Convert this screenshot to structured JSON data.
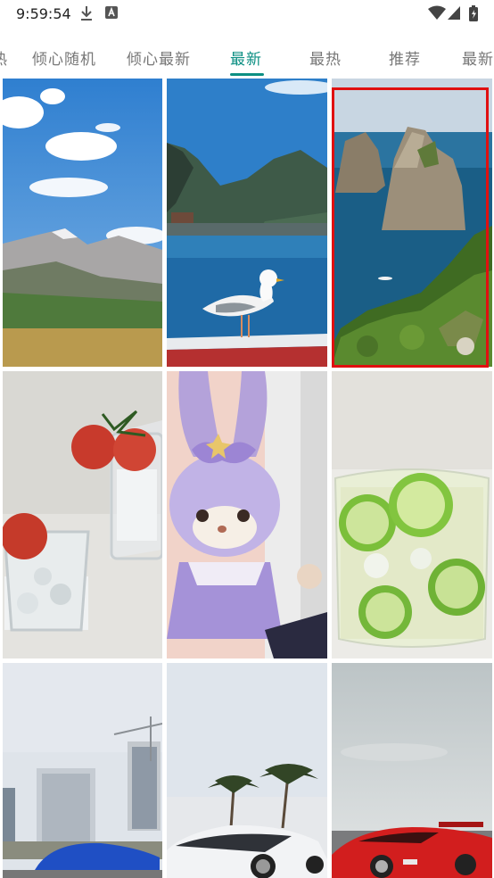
{
  "status": {
    "time": "9:59:54",
    "icons": [
      "download-icon",
      "font-app-icon",
      "wifi-icon",
      "signal-icon",
      "battery-icon"
    ]
  },
  "tabs": {
    "items": [
      {
        "label": "热"
      },
      {
        "label": "倾心随机"
      },
      {
        "label": "倾心最新"
      },
      {
        "label": "最新"
      },
      {
        "label": "最热"
      },
      {
        "label": "推荐"
      },
      {
        "label": "最新"
      }
    ],
    "active_index": 3
  },
  "colors": {
    "accent": "#0c8f83",
    "selection": "#e01010"
  },
  "gallery": {
    "selected_index": 2,
    "items": [
      {
        "subject": "mountain-sky"
      },
      {
        "subject": "seagull-lake"
      },
      {
        "subject": "sea-cliffs"
      },
      {
        "subject": "tomato-glasses"
      },
      {
        "subject": "plush-bunny"
      },
      {
        "subject": "cucumber-drink"
      },
      {
        "subject": "city-car"
      },
      {
        "subject": "palm-supercar"
      },
      {
        "subject": "red-supercar"
      }
    ]
  }
}
